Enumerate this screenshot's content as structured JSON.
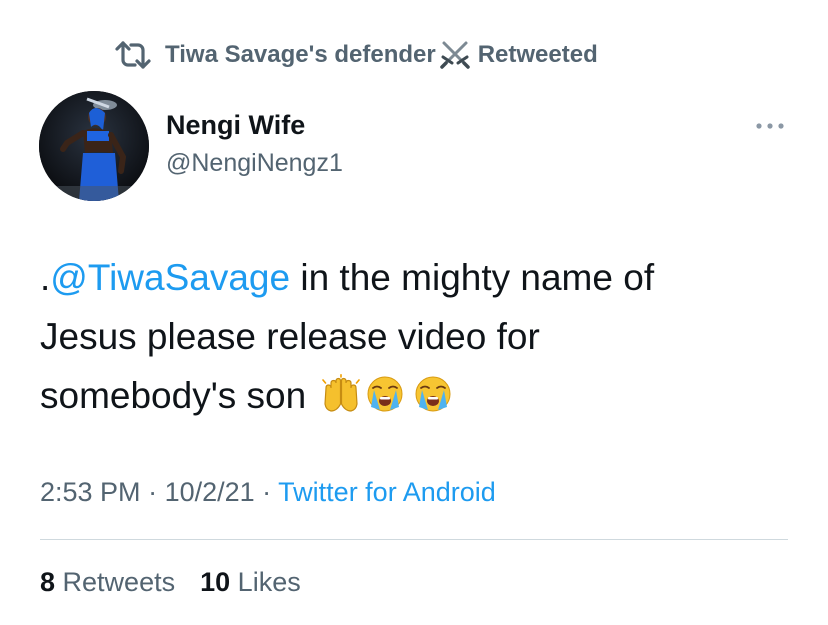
{
  "retweet_context": {
    "name": "Tiwa Savage's defender",
    "emoji_icon": "crossed-swords-icon",
    "label": "Retweeted"
  },
  "author": {
    "display_name": "Nengi Wife",
    "handle": "@NengiNengz1"
  },
  "tweet": {
    "prefix": ".",
    "mention": "@TiwaSavage",
    "text_line1": " in the mighty name of",
    "text_line2": "Jesus please release video for",
    "text_line3": "somebody's son ",
    "emojis": [
      "raising-hands-icon",
      "loudly-crying-face-icon",
      "loudly-crying-face-icon"
    ]
  },
  "meta": {
    "time": "2:53 PM",
    "separator": " · ",
    "date": "10/2/21",
    "separator2": " · ",
    "source": "Twitter for Android"
  },
  "stats": {
    "retweets_count": "8",
    "retweets_label": " Retweets",
    "likes_count": "10",
    "likes_label": " Likes"
  },
  "colors": {
    "accent": "#1d9bf0",
    "secondary_text": "#536471",
    "primary_text": "#0f1419",
    "divider": "#cfd9de"
  }
}
